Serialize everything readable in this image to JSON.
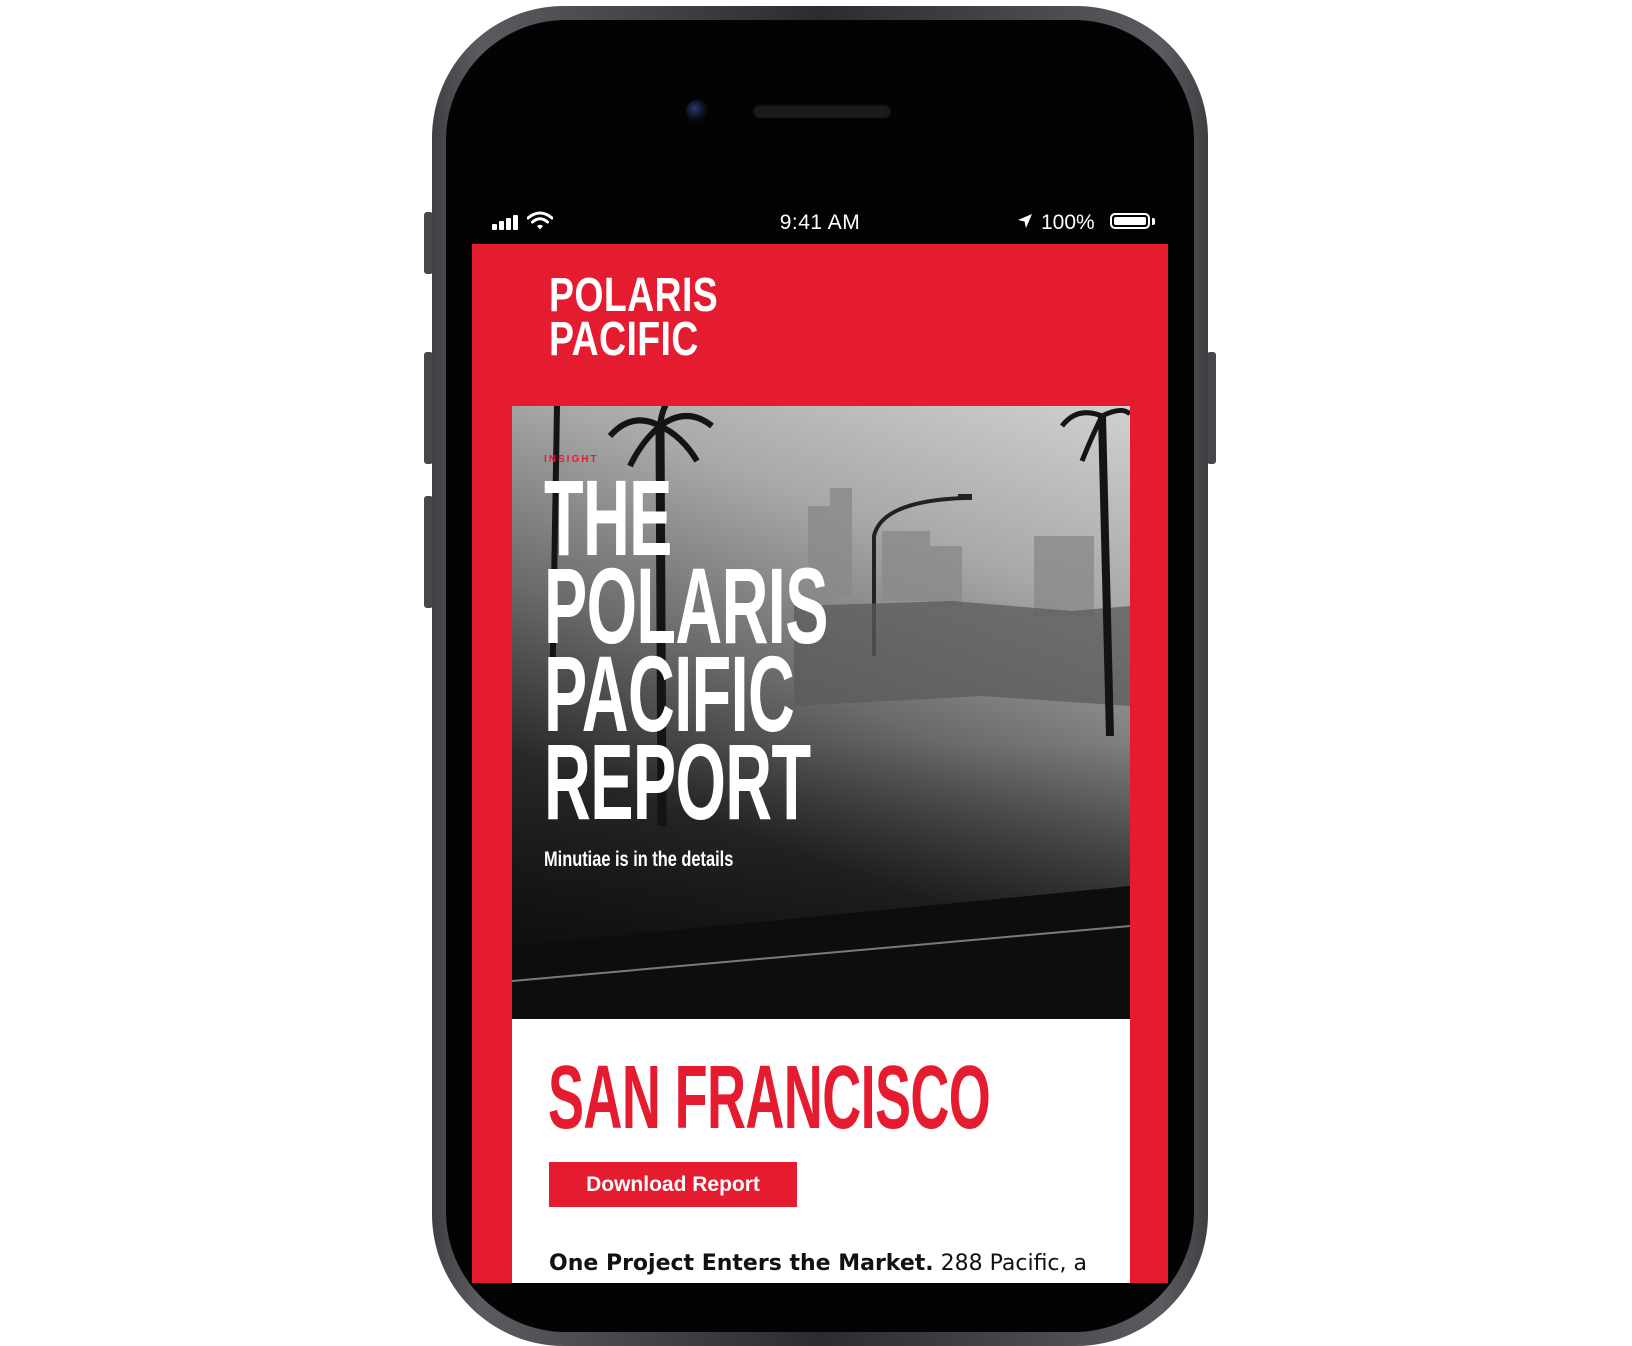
{
  "status_bar": {
    "time": "9:41 AM",
    "battery_percent": "100%",
    "icons": [
      "signal-icon",
      "wifi-icon",
      "location-arrow-icon",
      "battery-icon"
    ]
  },
  "email": {
    "brand": {
      "line1": "POLARIS",
      "line2": "PACIFIC"
    },
    "hero": {
      "eyebrow": "INSIGHT",
      "title_lines": [
        "THE",
        "POLARIS",
        "PACIFIC",
        "REPORT"
      ],
      "subtitle": "Minutiae is in the details"
    },
    "city": "SAN FRANCISCO",
    "download_label": "Download Report",
    "body": {
      "lead": "One Project Enters the Market.",
      "text": " 288 Pacific, a"
    }
  },
  "colors": {
    "accent": "#e51b2f",
    "status_bar": "#030303",
    "card": "#ffffff",
    "text": "#111111"
  }
}
